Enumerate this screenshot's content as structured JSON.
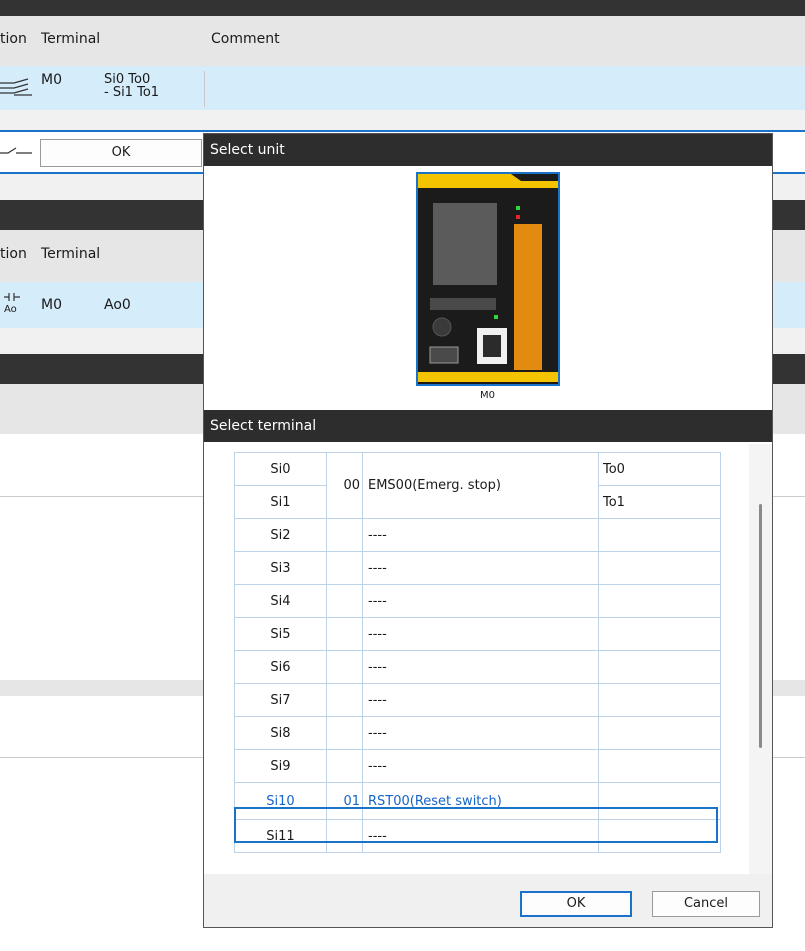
{
  "section1": {
    "columns": {
      "action": "tion",
      "terminal": "Terminal",
      "comment": "Comment"
    },
    "row": {
      "module": "M0",
      "terminal_line1": "Si0 To0",
      "terminal_line2": "- Si1 To1",
      "icon": "dual-channel-contact-icon"
    },
    "ok_label": "OK"
  },
  "section2": {
    "columns": {
      "action": "tion",
      "terminal": "Terminal"
    },
    "row": {
      "module": "M0",
      "terminal": "Ao0",
      "icon_label": "Ao"
    }
  },
  "dialog": {
    "unit_title": "Select unit",
    "unit_name": "M0",
    "terminal_title": "Select terminal",
    "terminals": [
      {
        "terminal": "Si0",
        "num": "00",
        "device": "EMS00(Emerg. stop)",
        "output": "To0"
      },
      {
        "terminal": "Si1",
        "num": "",
        "device": "",
        "output": "To1"
      },
      {
        "terminal": "Si2",
        "num": "",
        "device": "----",
        "output": ""
      },
      {
        "terminal": "Si3",
        "num": "",
        "device": "----",
        "output": ""
      },
      {
        "terminal": "Si4",
        "num": "",
        "device": "----",
        "output": ""
      },
      {
        "terminal": "Si5",
        "num": "",
        "device": "----",
        "output": ""
      },
      {
        "terminal": "Si6",
        "num": "",
        "device": "----",
        "output": ""
      },
      {
        "terminal": "Si7",
        "num": "",
        "device": "----",
        "output": ""
      },
      {
        "terminal": "Si8",
        "num": "",
        "device": "----",
        "output": ""
      },
      {
        "terminal": "Si9",
        "num": "",
        "device": "----",
        "output": ""
      },
      {
        "terminal": "Si10",
        "num": "01",
        "device": "RST00(Reset switch)",
        "output": ""
      },
      {
        "terminal": "Si11",
        "num": "",
        "device": "----",
        "output": ""
      }
    ],
    "ok_label": "OK",
    "cancel_label": "Cancel"
  },
  "colors": {
    "accent": "#1a73c8",
    "title_bar": "#2d2d2d",
    "selected_row": "#d5ecfb",
    "unit_yellow": "#f5c400"
  }
}
